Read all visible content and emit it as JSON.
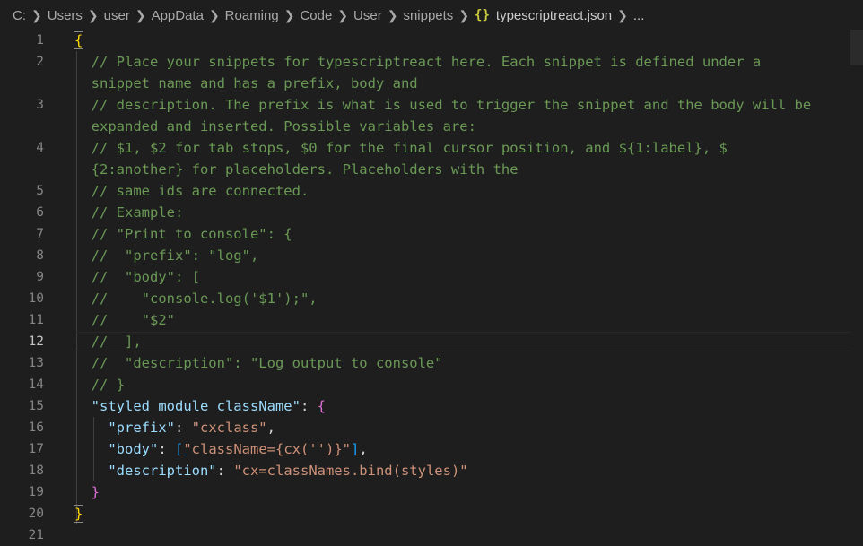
{
  "breadcrumb": {
    "segments": [
      "C:",
      "Users",
      "user",
      "AppData",
      "Roaming",
      "Code",
      "User",
      "snippets"
    ],
    "file_icon": "{}",
    "file_name": "typescriptreact.json",
    "ellipsis": "..."
  },
  "editor": {
    "active_line": 12,
    "line_numbers": [
      "1",
      "2",
      "",
      "3",
      "",
      "4",
      "",
      "5",
      "6",
      "7",
      "8",
      "9",
      "10",
      "11",
      "12",
      "13",
      "14",
      "15",
      "16",
      "17",
      "18",
      "19",
      "20",
      "21"
    ],
    "lines": {
      "l1": "{",
      "l2a": "  // Place your snippets for typescriptreact here. Each snippet is defined under a",
      "l2b": "  snippet name and has a prefix, body and",
      "l3a": "  // description. The prefix is what is used to trigger the snippet and the body will be",
      "l3b": "  expanded and inserted. Possible variables are:",
      "l4a": "  // $1, $2 for tab stops, $0 for the final cursor position, and ${1:label}, $",
      "l4b": "  {2:another} for placeholders. Placeholders with the",
      "l5": "  // same ids are connected.",
      "l6": "  // Example:",
      "l7": "  // \"Print to console\": {",
      "l8": "  //  \"prefix\": \"log\",",
      "l9": "  //  \"body\": [",
      "l10": "  //    \"console.log('$1');\",",
      "l11": "  //    \"$2\"",
      "l12": "  //  ],",
      "l13": "  //  \"description\": \"Log output to console\"",
      "l14": "  // }",
      "l15_key": "\"styled module className\"",
      "l15_colon": ": ",
      "l15_brace": "{",
      "l16_key": "\"prefix\"",
      "l16_colon": ": ",
      "l16_val": "\"cxclass\"",
      "l16_comma": ",",
      "l17_key": "\"body\"",
      "l17_colon": ": ",
      "l17_open": "[",
      "l17_val": "\"className={cx('')}\"",
      "l17_close": "]",
      "l17_comma": ",",
      "l18_key": "\"description\"",
      "l18_colon": ": ",
      "l18_val": "\"cx=classNames.bind(styles)\"",
      "l19": "}",
      "l20": "}"
    }
  },
  "colors": {
    "background": "#1e1e1e",
    "comment": "#6a9955",
    "key": "#9cdcfe",
    "string": "#ce9178",
    "bracket_gold": "#ffd700",
    "bracket_purple": "#da70d6",
    "bracket_blue": "#179fff"
  }
}
